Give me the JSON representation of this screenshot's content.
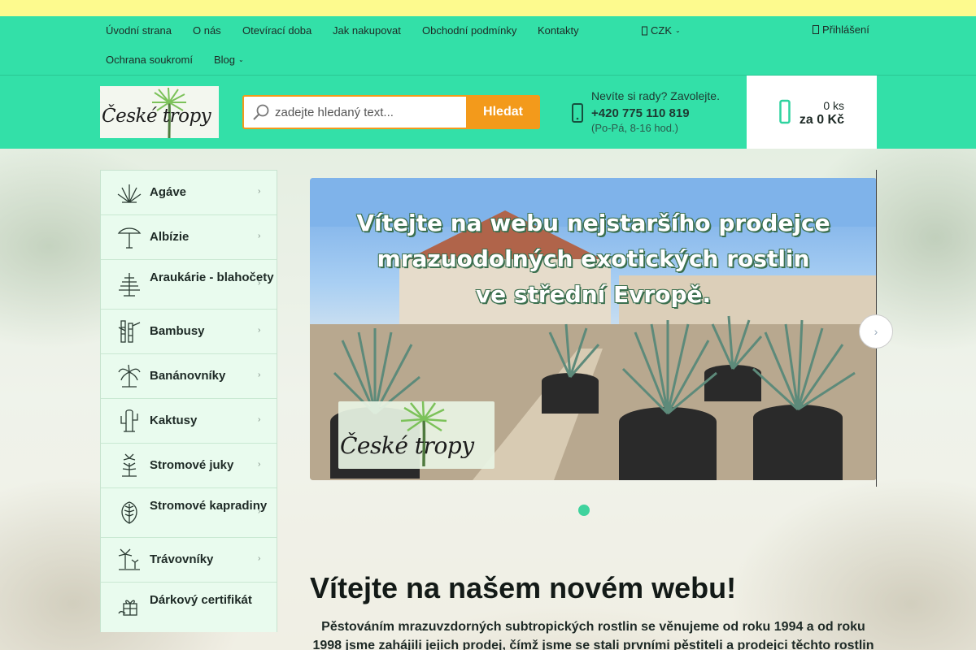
{
  "nav": {
    "links": [
      "Úvodní strana",
      "O nás",
      "Otevírací doba",
      "Jak nakupovat",
      "Obchodní podmínky",
      "Kontakty",
      "Ochrana soukromí",
      "Blog"
    ],
    "currency": "CZK",
    "login": "Přihlášení"
  },
  "header": {
    "logo_text": "České tropy",
    "search_placeholder": "zadejte hledaný text...",
    "search_button": "Hledat",
    "help_question": "Nevíte si rady? Zavolejte.",
    "help_phone": "+420 775 110 819",
    "help_hours": "(Po-Pá, 8-16 hod.)",
    "cart_qty": "0 ks",
    "cart_sum": "za 0 Kč"
  },
  "categories": [
    {
      "label": "Agáve",
      "icon": "agave-icon"
    },
    {
      "label": "Albízie",
      "icon": "albizia-icon"
    },
    {
      "label": "Araukárie - blahočety",
      "icon": "araucaria-icon"
    },
    {
      "label": "Bambusy",
      "icon": "bamboo-icon"
    },
    {
      "label": "Banánovníky",
      "icon": "banana-icon"
    },
    {
      "label": "Kaktusy",
      "icon": "cactus-icon"
    },
    {
      "label": "Stromové juky",
      "icon": "yucca-icon"
    },
    {
      "label": "Stromové kapradiny",
      "icon": "fern-icon"
    },
    {
      "label": "Trávovníky",
      "icon": "cordyline-icon"
    },
    {
      "label": "Dárkový certifikát",
      "icon": "gift-icon"
    }
  ],
  "slider": {
    "line1": "Vítejte na webu nejstaršího prodejce",
    "line2": "mrazuodolných exotických rostlin",
    "line3": "ve střední Evropě.",
    "logo_text": "České tropy"
  },
  "content": {
    "welcome": "Vítejte na našem novém webu!",
    "intro": "Pěstováním mrazuvzdorných subtropických rostlin se věnujeme od roku 1994 a od roku 1998 jsme zahájili jejich prodej, čímž jsme se stali prvními pěstiteli a prodejci těchto rostlin"
  },
  "colors": {
    "nav": "#33e0a8",
    "accent": "#f39a1b",
    "topstrip": "#fdfa8e"
  }
}
